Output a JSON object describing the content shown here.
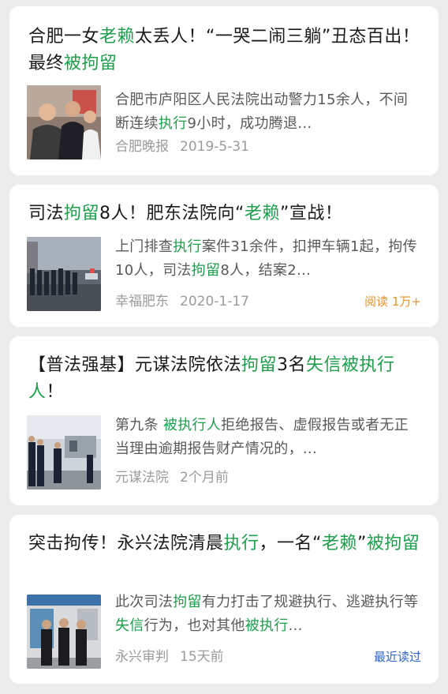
{
  "colors": {
    "highlight": "#1f9e4c",
    "read_badge": "#e8932a",
    "recent_badge": "#2d64c8"
  },
  "articles": [
    {
      "title": [
        {
          "t": "合肥一女",
          "h": false
        },
        {
          "t": "老赖",
          "h": true
        },
        {
          "t": "太丢人！“一哭二闹三躺”丑态百出！最终",
          "h": false
        },
        {
          "t": "被拘留",
          "h": true
        }
      ],
      "snippet": [
        {
          "t": "合肥市庐阳区人民法院出动警力15余人，不间断连续",
          "h": false
        },
        {
          "t": "执行",
          "h": true
        },
        {
          "t": "9小时，成功腾退...",
          "h": false
        }
      ],
      "source": "合肥晚报",
      "date": "2019-5-31",
      "badge": "",
      "thumb_icon": "news-photo-people"
    },
    {
      "title": [
        {
          "t": "司法",
          "h": false
        },
        {
          "t": "拘留",
          "h": true
        },
        {
          "t": "8人！肥东法院向“",
          "h": false
        },
        {
          "t": "老赖",
          "h": true
        },
        {
          "t": "”宣战！",
          "h": false
        }
      ],
      "snippet": [
        {
          "t": "上门排查",
          "h": false
        },
        {
          "t": "执行",
          "h": true
        },
        {
          "t": "案件31余件，扣押车辆1起，拘传10人，司法",
          "h": false
        },
        {
          "t": "拘留",
          "h": true
        },
        {
          "t": "8人，结案2...",
          "h": false
        }
      ],
      "source": "幸福肥东",
      "date": "2020-1-17",
      "badge": "阅读 1万+",
      "thumb_icon": "police-lineup-photo"
    },
    {
      "title": [
        {
          "t": "【普法强基】元谋法院依法",
          "h": false
        },
        {
          "t": "拘留",
          "h": true
        },
        {
          "t": "3名",
          "h": false
        },
        {
          "t": "失信被执行人",
          "h": true
        },
        {
          "t": "！",
          "h": false
        }
      ],
      "snippet": [
        {
          "t": "第九条 ",
          "h": false
        },
        {
          "t": "被执行人",
          "h": true
        },
        {
          "t": "拒绝报告、虚假报告或者无正当理由逾期报告财产情况的，...",
          "h": false
        }
      ],
      "source": "元谋法院",
      "date": "2个月前",
      "badge": "",
      "thumb_icon": "court-officers-photo"
    },
    {
      "title": [
        {
          "t": "突击拘传！永兴法院清晨",
          "h": false
        },
        {
          "t": "执行",
          "h": true
        },
        {
          "t": "，一名“",
          "h": false
        },
        {
          "t": "老赖",
          "h": true
        },
        {
          "t": "”",
          "h": false
        },
        {
          "t": "被拘留",
          "h": true
        }
      ],
      "snippet": [
        {
          "t": "此次司法",
          "h": false
        },
        {
          "t": "拘留",
          "h": true
        },
        {
          "t": "有力打击了规避执行、逃避执行等",
          "h": false
        },
        {
          "t": "失信",
          "h": true
        },
        {
          "t": "行为，也对其他",
          "h": false
        },
        {
          "t": "被执行",
          "h": true
        },
        {
          "t": "...",
          "h": false
        }
      ],
      "source": "永兴审判",
      "date": "15天前",
      "badge": "最近读过",
      "thumb_icon": "officers-detainee-photo"
    }
  ]
}
